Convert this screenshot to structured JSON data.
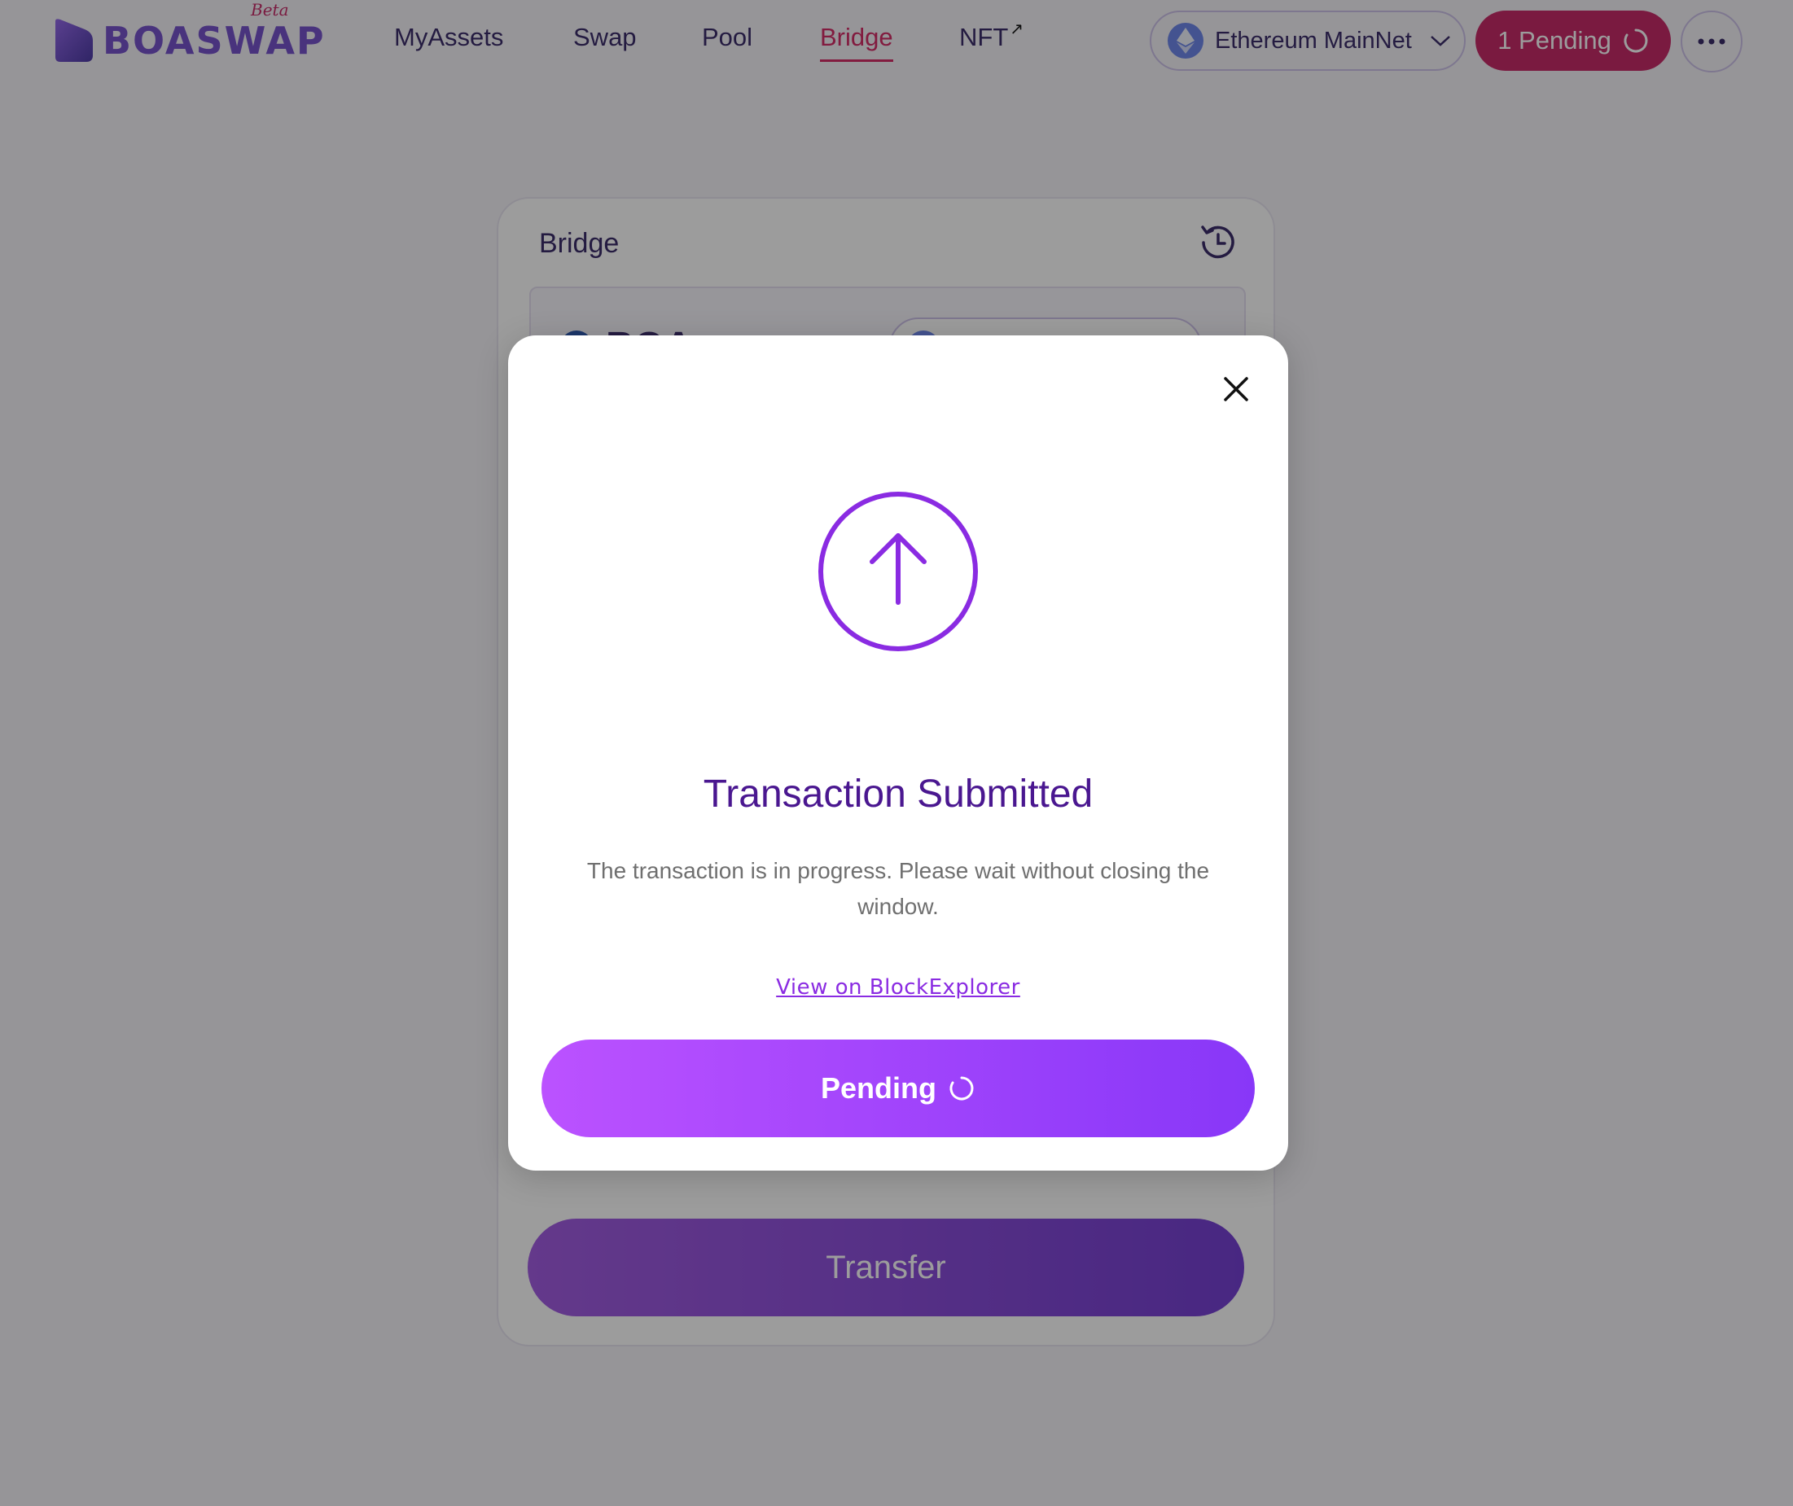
{
  "header": {
    "logo_text": "BOASWAP",
    "logo_badge": "Beta",
    "nav": [
      {
        "label": "MyAssets",
        "active": false
      },
      {
        "label": "Swap",
        "active": false
      },
      {
        "label": "Pool",
        "active": false
      },
      {
        "label": "Bridge",
        "active": true
      },
      {
        "label": "NFT",
        "active": false,
        "external_icon": "arrow-up-right-icon"
      }
    ],
    "network": {
      "label": "Ethereum MainNet",
      "icon": "ethereum-icon"
    },
    "pending": {
      "label": "1 Pending",
      "icon": "spinner-icon"
    },
    "more_icon": "more-horizontal-icon"
  },
  "bridge_card": {
    "title": "Bridge",
    "history_icon": "history-icon",
    "token_symbol": "BOA",
    "transfer_label": "Transfer"
  },
  "modal": {
    "icon": "arrow-up-circle-icon",
    "title": "Transaction Submitted",
    "message": "The transaction is in progress. Please wait without closing the window.",
    "explorer_link": "View on BlockExplorer",
    "button_label": "Pending",
    "close_icon": "close-icon"
  },
  "colors": {
    "accent_purple": "#8837f8",
    "brand_purple": "#6b45c8",
    "active_nav": "#d0195a",
    "pending_pill": "#c2185b",
    "modal_title": "#4a1790",
    "overlay": "rgba(30,30,30,0.44)"
  }
}
